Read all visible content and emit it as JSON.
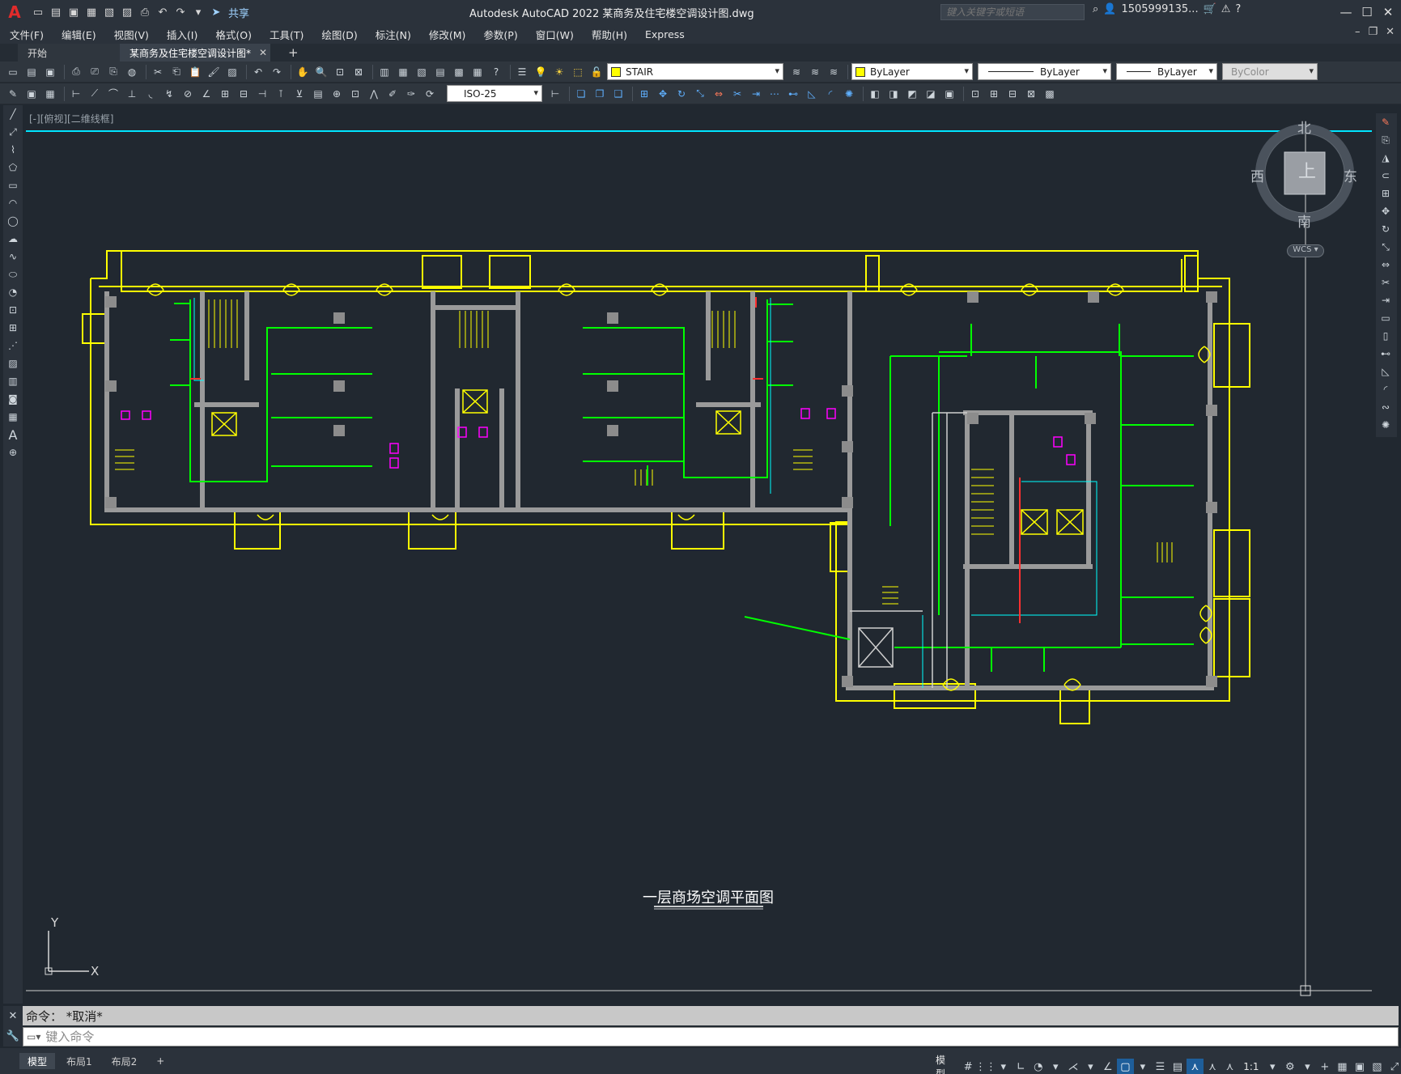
{
  "app": {
    "title": "Autodesk AutoCAD 2022    某商务及住宅楼空调设计图.dwg",
    "logo": "A",
    "share_label": "共享",
    "search_placeholder": "键入关键字或短语",
    "user": "1505999135...",
    "colors": {
      "background": "#212830",
      "chrome": "#2b323b",
      "wall": "#8c8c8c",
      "outline": "#ffff00",
      "duct": "#00ff00",
      "pipe": "#00ffff",
      "fixture": "#ff00ff",
      "title_line": "#00e5ff"
    }
  },
  "menu": [
    "文件(F)",
    "编辑(E)",
    "视图(V)",
    "插入(I)",
    "格式(O)",
    "工具(T)",
    "绘图(D)",
    "标注(N)",
    "修改(M)",
    "参数(P)",
    "窗口(W)",
    "帮助(H)",
    "Express"
  ],
  "tabs": {
    "start": "开始",
    "document": "某商务及住宅楼空调设计图*",
    "add": "+"
  },
  "toolbar": {
    "layer": "STAIR",
    "color": "ByLayer",
    "linetype": "ByLayer",
    "lineweight": "ByLayer",
    "plotstyle": "ByColor",
    "dimstyle": "ISO-25"
  },
  "viewport": {
    "label": "[-][俯视][二维线框]",
    "drawing_title": "一层商场空调平面图",
    "ucs": {
      "x": "X",
      "y": "Y"
    },
    "viewcube": {
      "north": "北",
      "south": "南",
      "west": "西",
      "east": "东",
      "face": "上",
      "wcs": "WCS"
    }
  },
  "command": {
    "history": "命令：  *取消*",
    "placeholder": "键入命令"
  },
  "status": {
    "layouts": [
      "模型",
      "布局1",
      "布局2"
    ],
    "add_layout": "+",
    "model": "模型",
    "scale": "1:1"
  }
}
